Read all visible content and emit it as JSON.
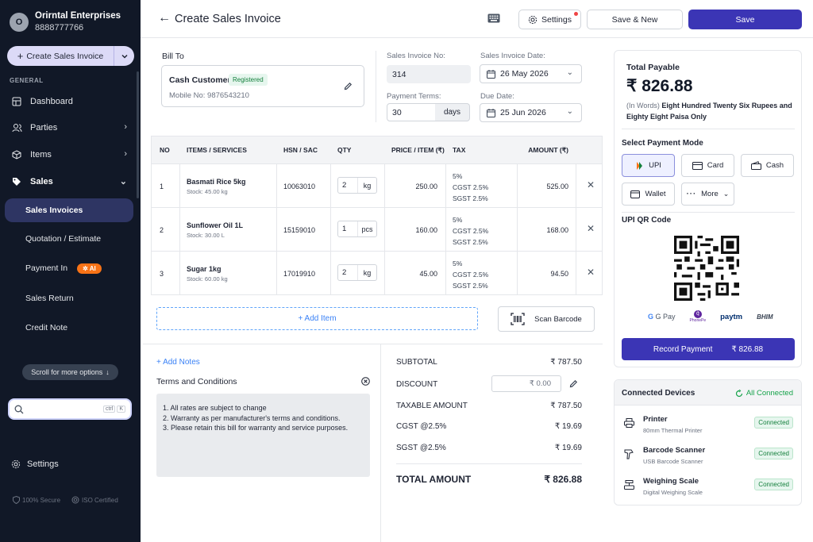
{
  "company": {
    "initial": "O",
    "name": "Orirntal Enterprises",
    "phone": "8888777766"
  },
  "sidebar": {
    "create_label": "Create Sales Invoice",
    "section_general": "GENERAL",
    "items": [
      {
        "label": "Dashboard",
        "icon": "dashboard-icon"
      },
      {
        "label": "Parties",
        "icon": "users-icon"
      },
      {
        "label": "Items",
        "icon": "box-icon"
      },
      {
        "label": "Sales",
        "icon": "tag-icon"
      }
    ],
    "sales_sub": [
      {
        "label": "Sales Invoices",
        "active": true
      },
      {
        "label": "Quotation / Estimate"
      },
      {
        "label": "Payment In",
        "badge": "AI"
      },
      {
        "label": "Sales Return"
      },
      {
        "label": "Credit Note"
      }
    ],
    "scroll_hint": "Scroll for more options",
    "search_kbd_1": "ctrl",
    "search_kbd_2": "K",
    "settings_label": "Settings",
    "trust_secure": "100% Secure",
    "trust_iso": "ISO Certified"
  },
  "header": {
    "title": "Create Sales Invoice",
    "settings_label": "Settings",
    "save_new_label": "Save & New",
    "save_label": "Save"
  },
  "bill": {
    "label": "Bill To",
    "customer": "Cash Customer",
    "status": "Registered",
    "mobile": "Mobile No: 9876543210"
  },
  "invoice": {
    "number_label": "Sales Invoice No:",
    "number": "314",
    "date_label": "Sales Invoice Date:",
    "date": "26 May 2026",
    "terms_label": "Payment Terms:",
    "terms_value": "30",
    "terms_unit": "days",
    "due_label": "Due Date:",
    "due_date": "25 Jun 2026"
  },
  "table": {
    "headers": [
      "NO",
      "ITEMS / SERVICES",
      "HSN / SAC",
      "QTY",
      "PRICE / ITEM (₹)",
      "TAX",
      "AMOUNT (₹)"
    ],
    "rows": [
      {
        "no": "1",
        "name": "Basmati Rice 5kg",
        "stock": "Stock: 45.00 kg",
        "hsn": "10063010",
        "qty": "2",
        "unit": "kg",
        "price": "250.00",
        "tax_rate": "5%",
        "cgst": "CGST 2.5%",
        "sgst": "SGST 2.5%",
        "amount": "525.00"
      },
      {
        "no": "2",
        "name": "Sunflower Oil 1L",
        "stock": "Stock: 30.00 L",
        "hsn": "15159010",
        "qty": "1",
        "unit": "pcs",
        "price": "160.00",
        "tax_rate": "5%",
        "cgst": "CGST 2.5%",
        "sgst": "SGST 2.5%",
        "amount": "168.00"
      },
      {
        "no": "3",
        "name": "Sugar 1kg",
        "stock": "Stock: 60.00 kg",
        "hsn": "17019910",
        "qty": "2",
        "unit": "kg",
        "price": "45.00",
        "tax_rate": "5%",
        "cgst": "CGST 2.5%",
        "sgst": "SGST 2.5%",
        "amount": "94.50"
      }
    ],
    "add_item_label": "+ Add Item",
    "scan_label": "Scan Barcode"
  },
  "notes": {
    "add_notes": "+ Add Notes",
    "terms_title": "Terms and Conditions",
    "terms": [
      "1. All rates are subject to change",
      "2. Warranty as per manufacturer's terms and conditions.",
      "3. Please retain this bill for warranty and service purposes."
    ]
  },
  "totals": {
    "subtotal_label": "SUBTOTAL",
    "subtotal": "₹ 787.50",
    "discount_label": "DISCOUNT",
    "discount": "₹ 0.00",
    "taxable_label": "TAXABLE AMOUNT",
    "taxable": "₹ 787.50",
    "cgst_label": "CGST @2.5%",
    "cgst": "₹ 19.69",
    "sgst_label": "SGST @2.5%",
    "sgst": "₹ 19.69",
    "total_label": "TOTAL AMOUNT",
    "total": "₹ 826.88"
  },
  "payment": {
    "title": "Total Payable",
    "amount": "₹ 826.88",
    "words_label": "(In Words)",
    "words": "Eight Hundred Twenty Six Rupees and Eighty Eight Paisa Only",
    "mode_title": "Select Payment Mode",
    "modes": [
      "UPI",
      "Card",
      "Cash",
      "Wallet",
      "More"
    ],
    "qr_title": "UPI QR Code",
    "logos": [
      "G Pay",
      "PhonePe",
      "paytm",
      "BHIM"
    ],
    "record_label": "Record Payment",
    "record_amount": "₹ 826.88"
  },
  "devices": {
    "title": "Connected Devices",
    "all_status": "All Connected",
    "list": [
      {
        "name": "Printer",
        "sub": "80mm Thermal Printer",
        "status": "Connected"
      },
      {
        "name": "Barcode Scanner",
        "sub": "USB Barcode Scanner",
        "status": "Connected"
      },
      {
        "name": "Weighing Scale",
        "sub": "Digital Weighing Scale",
        "status": "Connected"
      }
    ]
  },
  "colors": {
    "primary": "#3b35b5",
    "sidebar": "#111827",
    "success": "#16a34a",
    "link": "#3b82f6",
    "ai_badge": "#f97316"
  }
}
